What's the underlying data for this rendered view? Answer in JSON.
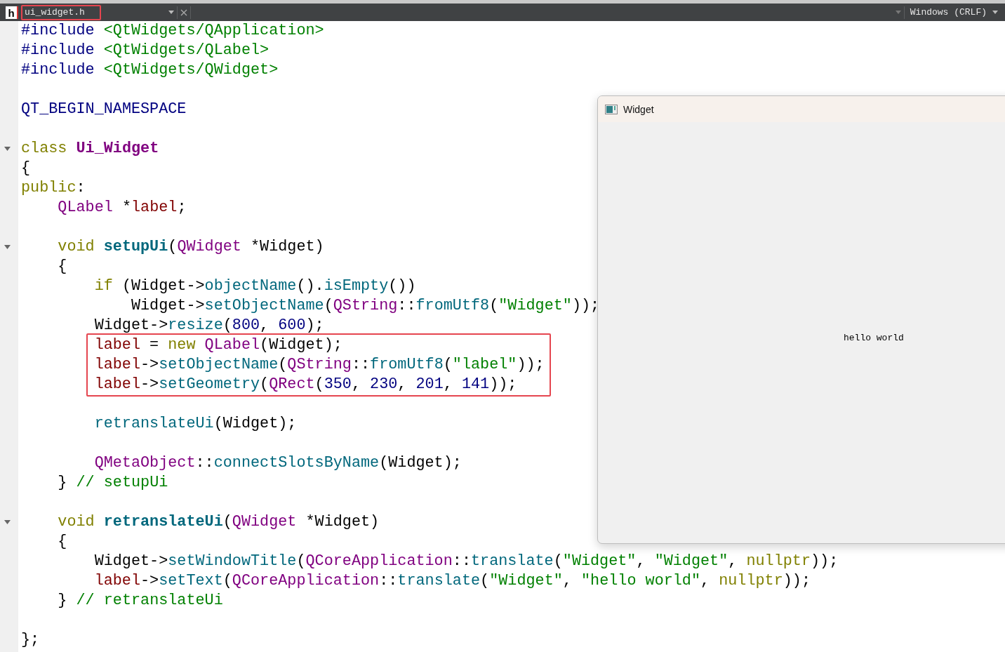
{
  "editor_tab": {
    "file_type": "h",
    "filename": "ui_widget.h",
    "boxed": true
  },
  "line_ending": "Windows (CRLF)",
  "code_blocks": [
    {
      "lines": [
        {
          "fold": false,
          "boxed": false,
          "tokens": [
            {
              "kind": "pp",
              "text": "#include "
            },
            {
              "kind": "str",
              "text": "<QtWidgets/QApplication>"
            }
          ]
        },
        {
          "fold": false,
          "boxed": false,
          "tokens": [
            {
              "kind": "pp",
              "text": "#include "
            },
            {
              "kind": "str",
              "text": "<QtWidgets/QLabel>"
            }
          ]
        },
        {
          "fold": false,
          "boxed": false,
          "tokens": [
            {
              "kind": "pp",
              "text": "#include "
            },
            {
              "kind": "str",
              "text": "<QtWidgets/QWidget>"
            }
          ]
        }
      ]
    },
    {
      "lines": [
        {
          "fold": false,
          "boxed": false,
          "tokens": [
            {
              "kind": "macro",
              "text": "QT_BEGIN_NAMESPACE"
            }
          ]
        }
      ]
    },
    {
      "lines": [
        {
          "fold": true,
          "boxed": false,
          "tokens": [
            {
              "kind": "kw",
              "text": "class "
            },
            {
              "kind": "cls",
              "text": "Ui_Widget"
            }
          ]
        },
        {
          "fold": false,
          "boxed": false,
          "tokens": [
            {
              "kind": "p",
              "text": "{"
            }
          ]
        },
        {
          "fold": false,
          "boxed": false,
          "tokens": [
            {
              "kind": "kw",
              "text": "public"
            },
            {
              "kind": "p",
              "text": ":"
            }
          ]
        },
        {
          "fold": false,
          "boxed": false,
          "tokens": [
            {
              "kind": "type",
              "text": "    QLabel "
            },
            {
              "kind": "p",
              "text": "*"
            },
            {
              "kind": "field",
              "text": "label"
            },
            {
              "kind": "p",
              "text": ";"
            }
          ]
        }
      ]
    },
    {
      "lines": [
        {
          "fold": true,
          "boxed": false,
          "tokens": [
            {
              "kind": "kw",
              "text": "    void "
            },
            {
              "kind": "decl",
              "text": "setupUi"
            },
            {
              "kind": "p",
              "text": "("
            },
            {
              "kind": "type",
              "text": "QWidget "
            },
            {
              "kind": "p",
              "text": "*Widget)"
            }
          ]
        },
        {
          "fold": false,
          "boxed": false,
          "tokens": [
            {
              "kind": "p",
              "text": "    {"
            }
          ]
        },
        {
          "fold": false,
          "boxed": false,
          "tokens": [
            {
              "kind": "kw",
              "text": "        if "
            },
            {
              "kind": "p",
              "text": "(Widget->"
            },
            {
              "kind": "fn",
              "text": "objectName"
            },
            {
              "kind": "p",
              "text": "()."
            },
            {
              "kind": "fn",
              "text": "isEmpty"
            },
            {
              "kind": "p",
              "text": "())"
            }
          ]
        },
        {
          "fold": false,
          "boxed": false,
          "tokens": [
            {
              "kind": "p",
              "text": "            Widget->"
            },
            {
              "kind": "fn",
              "text": "setObjectName"
            },
            {
              "kind": "p",
              "text": "("
            },
            {
              "kind": "type",
              "text": "QString"
            },
            {
              "kind": "p",
              "text": "::"
            },
            {
              "kind": "fn",
              "text": "fromUtf8"
            },
            {
              "kind": "p",
              "text": "("
            },
            {
              "kind": "str",
              "text": "\"Widget\""
            },
            {
              "kind": "p",
              "text": "));"
            }
          ]
        },
        {
          "fold": false,
          "boxed": false,
          "tokens": [
            {
              "kind": "p",
              "text": "        Widget->"
            },
            {
              "kind": "fn",
              "text": "resize"
            },
            {
              "kind": "p",
              "text": "("
            },
            {
              "kind": "num",
              "text": "800"
            },
            {
              "kind": "p",
              "text": ", "
            },
            {
              "kind": "num",
              "text": "600"
            },
            {
              "kind": "p",
              "text": ");"
            }
          ]
        },
        {
          "fold": false,
          "boxed": true,
          "tokens": [
            {
              "kind": "field",
              "text": "        label"
            },
            {
              "kind": "p",
              "text": " = "
            },
            {
              "kind": "kw",
              "text": "new "
            },
            {
              "kind": "type",
              "text": "QLabel"
            },
            {
              "kind": "p",
              "text": "(Widget);"
            }
          ]
        },
        {
          "fold": false,
          "boxed": true,
          "tokens": [
            {
              "kind": "field",
              "text": "        label"
            },
            {
              "kind": "p",
              "text": "->"
            },
            {
              "kind": "fn",
              "text": "setObjectName"
            },
            {
              "kind": "p",
              "text": "("
            },
            {
              "kind": "type",
              "text": "QString"
            },
            {
              "kind": "p",
              "text": "::"
            },
            {
              "kind": "fn",
              "text": "fromUtf8"
            },
            {
              "kind": "p",
              "text": "("
            },
            {
              "kind": "str",
              "text": "\"label\""
            },
            {
              "kind": "p",
              "text": "));"
            }
          ]
        },
        {
          "fold": false,
          "boxed": true,
          "tokens": [
            {
              "kind": "field",
              "text": "        label"
            },
            {
              "kind": "p",
              "text": "->"
            },
            {
              "kind": "fn",
              "text": "setGeometry"
            },
            {
              "kind": "p",
              "text": "("
            },
            {
              "kind": "type",
              "text": "QRect"
            },
            {
              "kind": "p",
              "text": "("
            },
            {
              "kind": "num",
              "text": "350"
            },
            {
              "kind": "p",
              "text": ", "
            },
            {
              "kind": "num",
              "text": "230"
            },
            {
              "kind": "p",
              "text": ", "
            },
            {
              "kind": "num",
              "text": "201"
            },
            {
              "kind": "p",
              "text": ", "
            },
            {
              "kind": "num",
              "text": "141"
            },
            {
              "kind": "p",
              "text": "));"
            }
          ]
        }
      ]
    },
    {
      "lines": [
        {
          "fold": false,
          "boxed": false,
          "tokens": [
            {
              "kind": "fn",
              "text": "        retranslateUi"
            },
            {
              "kind": "p",
              "text": "(Widget);"
            }
          ]
        }
      ]
    },
    {
      "lines": [
        {
          "fold": false,
          "boxed": false,
          "tokens": [
            {
              "kind": "type",
              "text": "        QMetaObject"
            },
            {
              "kind": "p",
              "text": "::"
            },
            {
              "kind": "fn",
              "text": "connectSlotsByName"
            },
            {
              "kind": "p",
              "text": "(Widget);"
            }
          ]
        },
        {
          "fold": false,
          "boxed": false,
          "tokens": [
            {
              "kind": "p",
              "text": "    } "
            },
            {
              "kind": "comment",
              "text": "// setupUi"
            }
          ]
        }
      ]
    },
    {
      "lines": [
        {
          "fold": true,
          "boxed": false,
          "tokens": [
            {
              "kind": "kw",
              "text": "    void "
            },
            {
              "kind": "decl",
              "text": "retranslateUi"
            },
            {
              "kind": "p",
              "text": "("
            },
            {
              "kind": "type",
              "text": "QWidget "
            },
            {
              "kind": "p",
              "text": "*Widget)"
            }
          ]
        },
        {
          "fold": false,
          "boxed": false,
          "tokens": [
            {
              "kind": "p",
              "text": "    {"
            }
          ]
        },
        {
          "fold": false,
          "boxed": false,
          "tokens": [
            {
              "kind": "p",
              "text": "        Widget->"
            },
            {
              "kind": "fn",
              "text": "setWindowTitle"
            },
            {
              "kind": "p",
              "text": "("
            },
            {
              "kind": "type",
              "text": "QCoreApplication"
            },
            {
              "kind": "p",
              "text": "::"
            },
            {
              "kind": "fn",
              "text": "translate"
            },
            {
              "kind": "p",
              "text": "("
            },
            {
              "kind": "str",
              "text": "\"Widget\""
            },
            {
              "kind": "p",
              "text": ", "
            },
            {
              "kind": "str",
              "text": "\"Widget\""
            },
            {
              "kind": "p",
              "text": ", "
            },
            {
              "kind": "kw",
              "text": "nullptr"
            },
            {
              "kind": "p",
              "text": "));"
            }
          ]
        },
        {
          "fold": false,
          "boxed": false,
          "tokens": [
            {
              "kind": "field",
              "text": "        label"
            },
            {
              "kind": "p",
              "text": "->"
            },
            {
              "kind": "fn",
              "text": "setText"
            },
            {
              "kind": "p",
              "text": "("
            },
            {
              "kind": "type",
              "text": "QCoreApplication"
            },
            {
              "kind": "p",
              "text": "::"
            },
            {
              "kind": "fn",
              "text": "translate"
            },
            {
              "kind": "p",
              "text": "("
            },
            {
              "kind": "str",
              "text": "\"Widget\""
            },
            {
              "kind": "p",
              "text": ", "
            },
            {
              "kind": "str",
              "text": "\"hello world\""
            },
            {
              "kind": "p",
              "text": ", "
            },
            {
              "kind": "kw",
              "text": "nullptr"
            },
            {
              "kind": "p",
              "text": "));"
            }
          ]
        },
        {
          "fold": false,
          "boxed": false,
          "tokens": [
            {
              "kind": "p",
              "text": "    } "
            },
            {
              "kind": "comment",
              "text": "// retranslateUi"
            }
          ]
        }
      ]
    },
    {
      "lines": [
        {
          "fold": false,
          "boxed": false,
          "tokens": [
            {
              "kind": "p",
              "text": "};"
            }
          ]
        }
      ]
    }
  ],
  "preview_window": {
    "title": "Widget",
    "label": "hello world"
  }
}
